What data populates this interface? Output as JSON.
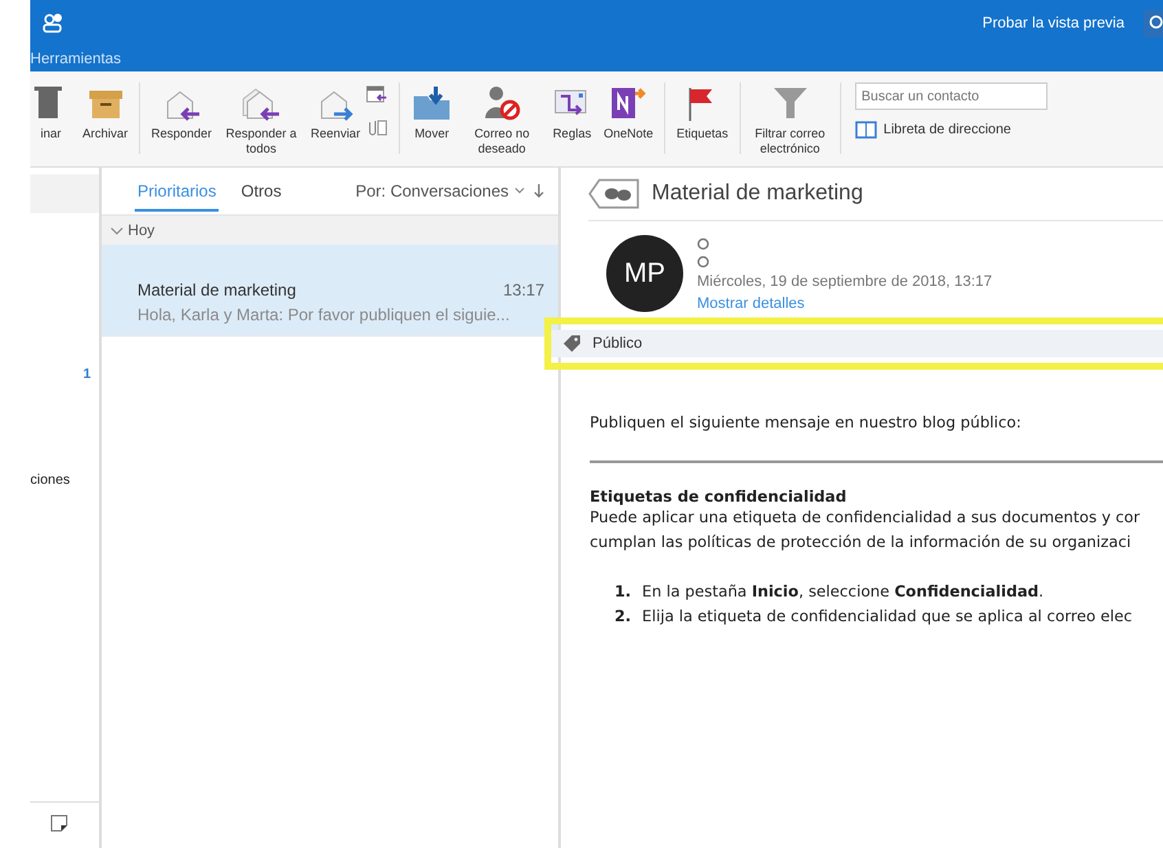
{
  "titlebar": {
    "preview_button": "Probar la vista previa"
  },
  "ribbon_tab": "Herramientas",
  "ribbon": [
    {
      "kind": "trash",
      "label": "inar"
    },
    {
      "kind": "archive",
      "label": "Archivar"
    },
    {
      "kind": "sep"
    },
    {
      "kind": "reply",
      "label": "Responder"
    },
    {
      "kind": "replyall",
      "label": "Responder a todos"
    },
    {
      "kind": "forward",
      "label": "Reenviar"
    },
    {
      "kind": "small"
    },
    {
      "kind": "sep"
    },
    {
      "kind": "move",
      "label": "Mover"
    },
    {
      "kind": "junk",
      "label": "Correo no deseado"
    },
    {
      "kind": "rules",
      "label": "Reglas"
    },
    {
      "kind": "onenote",
      "label": "OneNote"
    },
    {
      "kind": "sep"
    },
    {
      "kind": "flag",
      "label": "Etiquetas"
    },
    {
      "kind": "sep"
    },
    {
      "kind": "filter",
      "label": "Filtrar correo electrónico"
    },
    {
      "kind": "sep"
    }
  ],
  "contact_search": {
    "placeholder": "Buscar un contacto"
  },
  "address_book": "Libreta de direccione",
  "sidebar": {
    "count": "1",
    "item": "ciones"
  },
  "list": {
    "tabs": [
      {
        "label": "Prioritarios",
        "selected": true
      },
      {
        "label": "Otros",
        "selected": false
      }
    ],
    "sort": "Por: Conversaciones",
    "group": {
      "label": "Hoy",
      "expanded": true
    },
    "messages": [
      {
        "subject": "Material de marketing",
        "time": "13:17",
        "preview": "Hola, Karla y Marta: Por favor publiquen el siguie...",
        "selected": true
      }
    ]
  },
  "reading": {
    "subject": "Material de marketing",
    "initials": "MP",
    "date": "Miércoles, 19 de septiembre de 2018, 13:17",
    "details_link": "Mostrar detalles",
    "label": "Público",
    "body": [
      {
        "kind": "para",
        "text": "Publiquen el siguiente mensaje en nuestro blog público:"
      },
      {
        "kind": "rule"
      },
      {
        "kind": "heading",
        "text": "Etiquetas de confidencialidad"
      },
      {
        "kind": "para",
        "text": "Puede aplicar una etiqueta de confidencialidad a sus documentos y cor"
      },
      {
        "kind": "para",
        "text": "cumplan las políticas de protección de la información de su organizaci"
      },
      {
        "kind": "item",
        "num": "1.",
        "text": "En la pestaña **Inicio**, seleccione **Confidencialidad**."
      },
      {
        "kind": "item",
        "num": "2.",
        "text": "Elija la etiqueta de confidencialidad que se aplica al correo elec"
      }
    ]
  }
}
